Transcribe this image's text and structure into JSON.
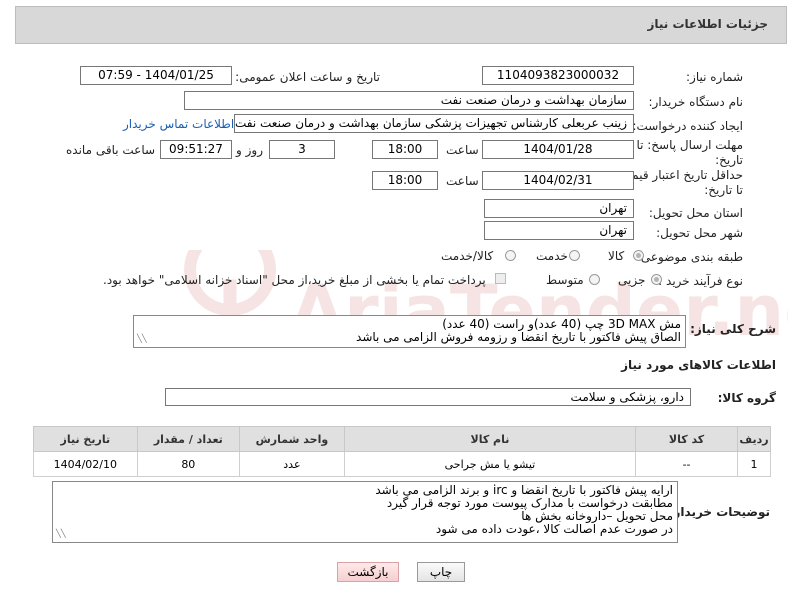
{
  "header": {
    "title": "جزئیات اطلاعات نیاز"
  },
  "watermark": {
    "text": "AriaTender.net"
  },
  "fields": {
    "need_number": {
      "label": "شماره نیاز:",
      "value": "1104093823000032"
    },
    "announce": {
      "label": "تاریخ و ساعت اعلان عمومی:",
      "value": "1404/01/25 - 07:59"
    },
    "buyer_org": {
      "label": "نام دستگاه خریدار:",
      "value": "سازمان بهداشت و درمان صنعت نفت"
    },
    "requester": {
      "label": "ایجاد کننده درخواست:",
      "value": "زینب عربعلی کارشناس تجهیزات پزشکی سازمان بهداشت و درمان صنعت نفت",
      "contact_link": "اطلاعات تماس خریدار"
    },
    "reply_deadline": {
      "label_line1": "مهلت ارسال پاسخ: تا",
      "label_line2": "تاریخ:",
      "date": "1404/01/28",
      "time_label": "ساعت",
      "time": "18:00",
      "days": "3",
      "days_label": "روز و",
      "remaining": "09:51:27",
      "remaining_label": "ساعت باقی مانده"
    },
    "price_validity": {
      "label_line1": "حداقل تاریخ اعتبار قیمت:",
      "label_line2": "تا تاریخ:",
      "date": "1404/02/31",
      "time_label": "ساعت",
      "time": "18:00"
    },
    "delivery_province": {
      "label": "استان محل تحویل:",
      "value": "تهران"
    },
    "delivery_city": {
      "label": "شهر محل تحویل:",
      "value": "تهران"
    },
    "category": {
      "label": "طبقه بندی موضوعی:",
      "options": [
        "کالا",
        "خدمت",
        "کالا/خدمت"
      ],
      "selected": "کالا"
    },
    "process_type": {
      "label": "نوع فرآیند خرید :",
      "options": [
        "جزیی",
        "متوسط"
      ],
      "selected": "جزیی",
      "payment_note": "پرداخت تمام یا بخشی از مبلغ خرید،از محل \"اسناد خزانه اسلامی\" خواهد بود."
    }
  },
  "general_desc": {
    "label": "شرح کلی نیاز:",
    "line1": "مش 3D MAX چپ  (40 عدد)و راست (40 عدد)",
    "line2": "الصاق پیش فاکتور با تاریخ انقضا و رزومه فروش الزامی می باشد"
  },
  "goods_info": {
    "title": "اطلاعات کالاهای مورد نیاز",
    "group_label": "گروه کالا:",
    "group_value": "دارو، پزشکی و سلامت"
  },
  "table": {
    "columns": [
      "ردیف",
      "کد کالا",
      "نام کالا",
      "واحد شمارش",
      "تعداد / مقدار",
      "تاریخ نیاز"
    ],
    "rows": [
      {
        "row": "1",
        "code": "--",
        "name": "تیشو یا مش جراحی",
        "unit": "عدد",
        "qty": "80",
        "date": "1404/02/10"
      }
    ]
  },
  "buyer_notes": {
    "label": "توضیحات خریدار:",
    "lines": [
      "ارایه  پیش فاکتور با تاریخ انقضا و irc  و برند الزامی می باشد",
      "مطابقت درخواست با مدارک پیوست مورد توجه قرار گیرد",
      "محل تحویل –داروخانه بخش ها",
      "در صورت عدم اصالت کالا ،عودت داده می شود"
    ]
  },
  "buttons": {
    "print": "چاپ",
    "back": "بازگشت"
  }
}
